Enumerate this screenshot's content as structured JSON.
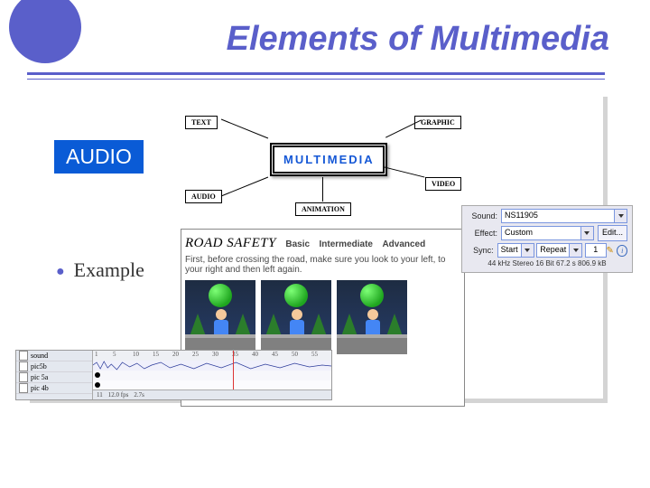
{
  "title": "Elements of Multimedia",
  "badge": "AUDIO",
  "bullet": "Example",
  "diagram": {
    "center": "MULTIMEDIA",
    "nodes": {
      "text": "TEXT",
      "audio": "AUDIO",
      "animation": "ANIMATION",
      "graphic": "GRAPHIC",
      "video": "VIDEO"
    }
  },
  "road_safety": {
    "title": "ROAD SAFETY",
    "levels": [
      "Basic",
      "Intermediate",
      "Advanced"
    ],
    "text": "First, before crossing the road, make sure you look to your left, to your right and then left again."
  },
  "sound_panel": {
    "labels": {
      "sound": "Sound:",
      "effect": "Effect:",
      "sync": "Sync:"
    },
    "sound_value": "NS11905",
    "effect_value": "Custom",
    "edit_button": "Edit...",
    "sync_mode": "Start",
    "sync_repeat": "Repeat",
    "sync_count": "1",
    "footer": "44 kHz Stereo 16 Bit 67.2 s 806.9 kB"
  },
  "timeline": {
    "layers": [
      "sound",
      "pic5b",
      "pic 5a",
      "pic 4b"
    ],
    "ticks": [
      "1",
      "5",
      "10",
      "15",
      "20",
      "25",
      "30",
      "35",
      "40",
      "45",
      "50",
      "55"
    ],
    "foot": {
      "frame": "11",
      "fps": "12.0 fps",
      "time": "2.7s"
    }
  }
}
